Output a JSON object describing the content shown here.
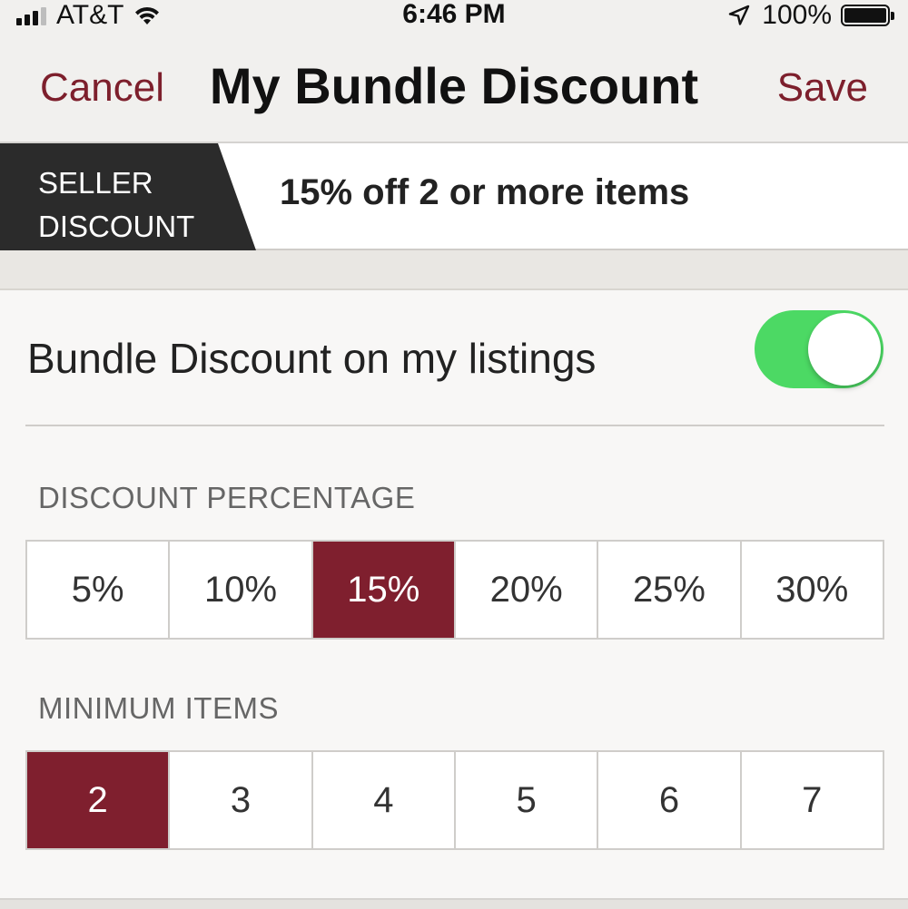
{
  "status_bar": {
    "carrier": "AT&T",
    "time": "6:46 PM",
    "battery": "100%",
    "icons": [
      "signal-icon",
      "wifi-icon",
      "location-arrow-icon",
      "battery-icon"
    ]
  },
  "nav": {
    "cancel_label": "Cancel",
    "title": "My Bundle Discount",
    "save_label": "Save"
  },
  "banner": {
    "badge_line1": "SELLER",
    "badge_line2": "DISCOUNT",
    "text": "15% off 2 or more items"
  },
  "toggle": {
    "label": "Bundle Discount on my listings",
    "on": true
  },
  "discount_percentage": {
    "label": "DISCOUNT PERCENTAGE",
    "options": [
      "5%",
      "10%",
      "15%",
      "20%",
      "25%",
      "30%"
    ],
    "selected": "15%"
  },
  "minimum_items": {
    "label": "MINIMUM ITEMS",
    "options": [
      "2",
      "3",
      "4",
      "5",
      "6",
      "7"
    ],
    "selected": "2"
  },
  "colors": {
    "accent": "#7f1f2e",
    "toggle_on": "#4cd964",
    "badge_bg": "#2b2b2b"
  }
}
